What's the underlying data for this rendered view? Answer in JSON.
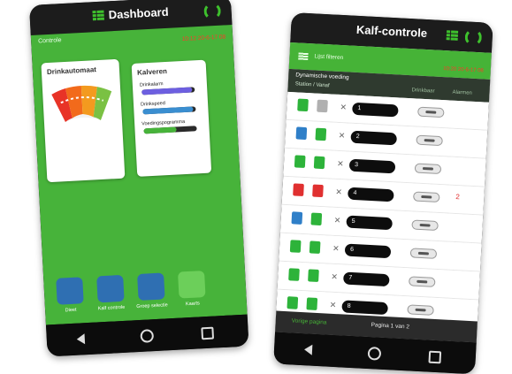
{
  "dashboard": {
    "title": "Dashboard",
    "control_label": "Controle",
    "timestamp": "10:12 20-6-17 08",
    "drink_card": {
      "title": "Drinkautomaat"
    },
    "calves_card": {
      "title": "Kalveren",
      "bars": [
        {
          "label": "Drinkalarm",
          "fill": 0.95,
          "color": "#6d5fe0"
        },
        {
          "label": "Drinkspeed",
          "fill": 0.95,
          "color": "#3a8ed0"
        },
        {
          "label": "Voedingspogramma",
          "fill": 0.62,
          "color": "#47b33a"
        }
      ]
    },
    "tiles": [
      {
        "label": "Dieet",
        "icon": "barn-icon"
      },
      {
        "label": "Kalf controle",
        "icon": "calf-icon"
      },
      {
        "label": "Groep selectie",
        "icon": "group-icon"
      },
      {
        "label": "Kaarts",
        "icon": "map-icon"
      }
    ]
  },
  "calf_control": {
    "title": "Kalf-controle",
    "filter_label": "Lijst filteren",
    "timestamp": "10:20 20-6-17 08",
    "section_title": "Dynamische voeding",
    "sort_label": "Station / Vanaf",
    "columns": [
      "Drinkbaar",
      "Alarmen"
    ],
    "rows": [
      {
        "id": "1",
        "color_a": "#2db33a",
        "color_b": "#b0b0b0",
        "alarm": ""
      },
      {
        "id": "2",
        "color_a": "#2f7fc8",
        "color_b": "#2db33a",
        "alarm": ""
      },
      {
        "id": "3",
        "color_a": "#2db33a",
        "color_b": "#2db33a",
        "alarm": ""
      },
      {
        "id": "4",
        "color_a": "#e03030",
        "color_b": "#e03030",
        "alarm": "2"
      },
      {
        "id": "5",
        "color_a": "#2f7fc8",
        "color_b": "#2db33a",
        "alarm": ""
      },
      {
        "id": "6",
        "color_a": "#2db33a",
        "color_b": "#2db33a",
        "alarm": ""
      },
      {
        "id": "7",
        "color_a": "#2db33a",
        "color_b": "#2db33a",
        "alarm": ""
      },
      {
        "id": "8",
        "color_a": "#2db33a",
        "color_b": "#2db33a",
        "alarm": ""
      }
    ],
    "pager": {
      "prev": "Vorige pagina",
      "page": "Pagina 1 van 2"
    }
  }
}
